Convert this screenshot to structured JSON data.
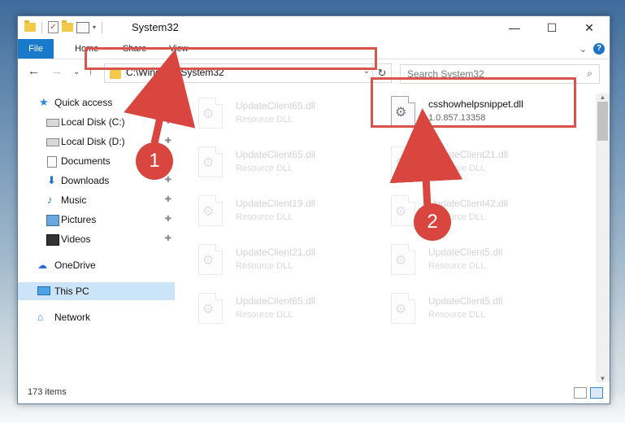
{
  "window": {
    "title": "System32"
  },
  "ribbon": {
    "tabs": [
      "File",
      "Home",
      "Share",
      "View"
    ],
    "help": "?"
  },
  "controls": {
    "minimize": "—",
    "maximize": "☐",
    "close": "✕",
    "expand": "⌄"
  },
  "address": {
    "path": "C:\\Windows\\System32",
    "dropdown": "⌄",
    "refresh": "↻"
  },
  "search": {
    "placeholder": "Search System32",
    "icon": "⌕"
  },
  "nav": {
    "back": "←",
    "forward": "→",
    "recent": "⌄",
    "up": "↑",
    "items": [
      {
        "label": "Quick access",
        "icon": "star-icon"
      },
      {
        "label": "Local Disk (C:)",
        "icon": "drive-icon",
        "pinned": true
      },
      {
        "label": "Local Disk (D:)",
        "icon": "drive-icon",
        "pinned": true
      },
      {
        "label": "Documents",
        "icon": "documents-icon",
        "pinned": true
      },
      {
        "label": "Downloads",
        "icon": "download-icon",
        "pinned": true
      },
      {
        "label": "Music",
        "icon": "music-icon",
        "pinned": true
      },
      {
        "label": "Pictures",
        "icon": "pictures-icon",
        "pinned": true
      },
      {
        "label": "Videos",
        "icon": "videos-icon",
        "pinned": true
      },
      {
        "label": "OneDrive",
        "icon": "cloud-icon"
      },
      {
        "label": "This PC",
        "icon": "computer-icon",
        "selected": true
      },
      {
        "label": "Network",
        "icon": "network-icon"
      }
    ],
    "pin_glyph": "✚"
  },
  "files": [
    {
      "name": "UpdateClient65.dll",
      "desc": "Resource DLL",
      "faded": true
    },
    {
      "name": "csshowhelpsnippet.dll",
      "desc": "1.0.857.13358",
      "faded": false
    },
    {
      "name": "UpdateClient65.dll",
      "desc": "Resource DLL",
      "faded": true
    },
    {
      "name": "UpdateClient21.dll",
      "desc": "Resource DLL",
      "faded": true
    },
    {
      "name": "UpdateClient19.dll",
      "desc": "Resource DLL",
      "faded": true
    },
    {
      "name": "UpdateClient42.dll",
      "desc": "Resource DLL",
      "faded": true
    },
    {
      "name": "UpdateClient21.dll",
      "desc": "Resource DLL",
      "faded": true
    },
    {
      "name": "UpdateClient5.dll",
      "desc": "Resource DLL",
      "faded": true
    },
    {
      "name": "UpdateClient65.dll",
      "desc": "Resource DLL",
      "faded": true
    },
    {
      "name": "UpdateClient5.dll",
      "desc": "Resource DLL",
      "faded": true
    }
  ],
  "status": {
    "items": "173 items"
  },
  "annotations": {
    "step1": "1",
    "step2": "2",
    "color": "#d9453f"
  }
}
